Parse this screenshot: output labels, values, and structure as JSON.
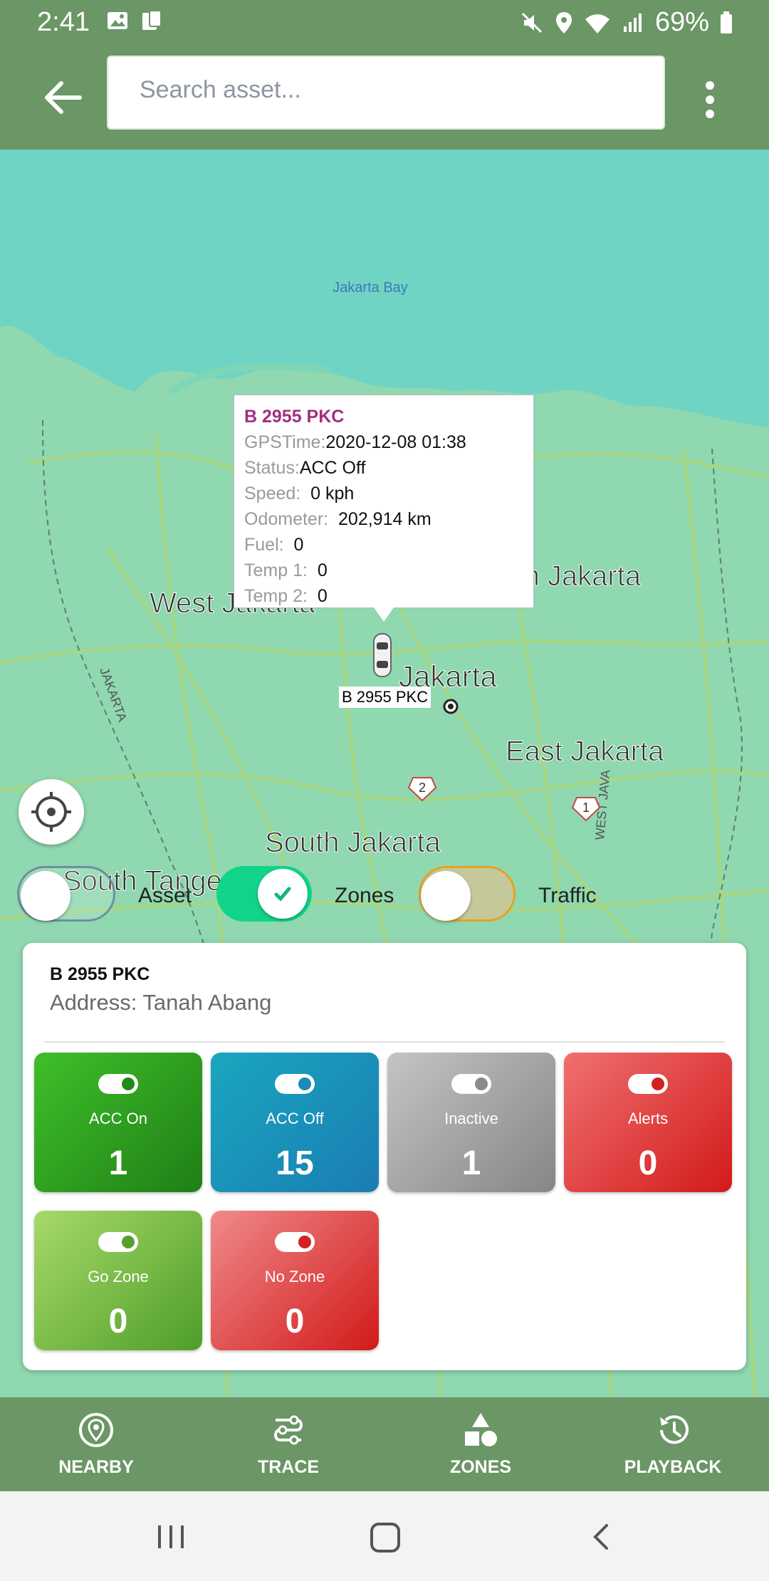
{
  "status_bar": {
    "time": "2:41",
    "battery": "69%"
  },
  "search": {
    "placeholder": "Search asset..."
  },
  "map": {
    "labels": {
      "bay": "Jakarta Bay",
      "west_jakarta": "West Jakarta",
      "north_jakarta": "North Jakarta",
      "jakarta": "Jakarta",
      "east_jakarta": "East Jakarta",
      "south_jakarta": "South Jakarta",
      "south_tangerang": "South Tangerang",
      "jakarta_road": "JAKARTA",
      "west_java": "WEST JAVA",
      "route_2": "2",
      "route_1": "1"
    },
    "vehicle_label": "B 2955 PKC"
  },
  "popup": {
    "title": "B 2955 PKC",
    "rows": [
      {
        "key": "GPSTime:",
        "value": "2020-12-08 01:38"
      },
      {
        "key": "Status:",
        "value": "ACC Off"
      },
      {
        "key": "Speed:",
        "value": "0 kph"
      },
      {
        "key": "Odometer:",
        "value": "202,914 km"
      },
      {
        "key": "Fuel:",
        "value": "0"
      },
      {
        "key": "Temp 1:",
        "value": "0"
      },
      {
        "key": "Temp 2:",
        "value": "0"
      }
    ]
  },
  "toggles": {
    "asset": {
      "label": "Asset",
      "on": false
    },
    "zones": {
      "label": "Zones",
      "on": true
    },
    "traffic": {
      "label": "Traffic",
      "on": false
    }
  },
  "asset_card": {
    "plate": "B 2955 PKC",
    "address": "Address: Tanah Abang"
  },
  "tiles": [
    {
      "label": "ACC On",
      "count": "1",
      "color_from": "#3fbf2a",
      "color_to": "#1f7f16",
      "dot": "#1f8a18"
    },
    {
      "label": "ACC Off",
      "count": "15",
      "color_from": "#1aa6c0",
      "color_to": "#1a7db3",
      "dot": "#1a8cb8"
    },
    {
      "label": "Inactive",
      "count": "1",
      "color_from": "#c4c4c4",
      "color_to": "#868686",
      "dot": "#8a8a8a"
    },
    {
      "label": "Alerts",
      "count": "0",
      "color_from": "#f07070",
      "color_to": "#d21a1a",
      "dot": "#d42020"
    },
    {
      "label": "Go Zone",
      "count": "0",
      "color_from": "#a7d96a",
      "color_to": "#4f9e2a",
      "dot": "#56a02e"
    },
    {
      "label": "No Zone",
      "count": "0",
      "color_from": "#f08a8a",
      "color_to": "#d21a1a",
      "dot": "#d42020"
    }
  ],
  "bottom_nav": [
    {
      "label": "NEARBY",
      "icon": "location-pin-icon"
    },
    {
      "label": "TRACE",
      "icon": "route-icon"
    },
    {
      "label": "ZONES",
      "icon": "shapes-icon"
    },
    {
      "label": "PLAYBACK",
      "icon": "history-icon"
    }
  ],
  "colors": {
    "appbar": "#6b9666",
    "water": "#6fd4c4",
    "land": "#8fd8b0",
    "popup_title": "#a0307d",
    "zones_toggle": "#11d48a",
    "traffic_toggle_border": "#e5a21f"
  }
}
